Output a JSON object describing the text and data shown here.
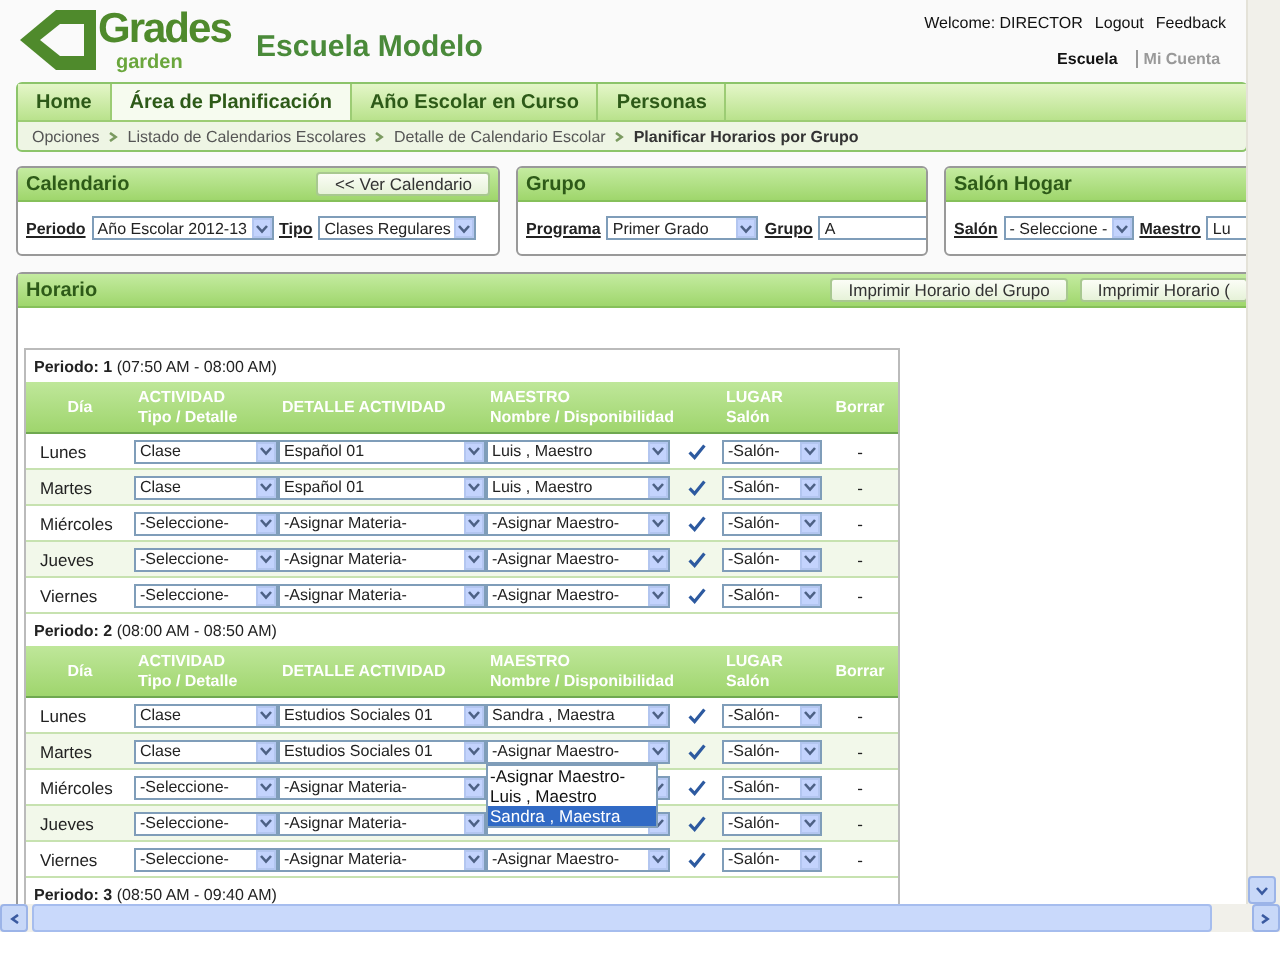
{
  "logo": {
    "main": "Grades",
    "sub": "garden"
  },
  "school_name": "Escuela Modelo",
  "user_links": [
    "Welcome: DIRECTOR",
    "Logout",
    "Feedback"
  ],
  "account_links": [
    {
      "label": "Escuela",
      "selected": true
    },
    {
      "label": "Mi Cuenta",
      "selected": false
    }
  ],
  "tabs": [
    {
      "label": "Home",
      "selected": false
    },
    {
      "label": "Área de Planificación",
      "selected": true
    },
    {
      "label": "Año Escolar en Curso",
      "selected": false
    },
    {
      "label": "Personas",
      "selected": false
    }
  ],
  "breadcrumb": [
    "Opciones",
    "Listado de Calendarios Escolares",
    "Detalle de Calendario Escolar",
    "Planificar Horarios por Grupo"
  ],
  "filter_panels": [
    {
      "title": "Calendario",
      "button": "<< Ver Calendario",
      "fields": [
        {
          "label": "Periodo",
          "value": "Año Escolar 2012-13"
        },
        {
          "label": "Tipo",
          "value": "Clases Regulares"
        }
      ]
    },
    {
      "title": "Grupo",
      "fields": [
        {
          "label": "Programa",
          "value": "Primer Grado"
        },
        {
          "label": "Grupo",
          "value": "A"
        }
      ]
    },
    {
      "title": "Salón Hogar",
      "fields": [
        {
          "label": "Salón",
          "value": "- Seleccione -"
        },
        {
          "label": "Maestro",
          "value": "Lu"
        }
      ]
    }
  ],
  "schedule": {
    "title": "Horario",
    "buttons": [
      "Imprimir Horario del Grupo",
      "Imprimir Horario ("
    ],
    "periods": [
      {
        "label": "Periodo: 1",
        "time": "(07:50 AM - 08:00 AM)",
        "columns": [
          [
            "Día"
          ],
          [
            "ACTIVIDAD",
            "Tipo / Detalle"
          ],
          [
            "DETALLE ACTIVIDAD"
          ],
          [
            "MAESTRO",
            "Nombre / Disponibilidad"
          ],
          [],
          [
            "LUGAR",
            "Salón"
          ],
          [
            "Borrar"
          ]
        ],
        "rows": [
          {
            "day": "Lunes",
            "activity": "Clase",
            "detail": "Español 01",
            "teacher": "Luis , Maestro",
            "available": true,
            "place": "-Salón-",
            "delete": "-"
          },
          {
            "day": "Martes",
            "activity": "Clase",
            "detail": "Español 01",
            "teacher": "Luis , Maestro",
            "available": true,
            "place": "-Salón-",
            "delete": "-"
          },
          {
            "day": "Miércoles",
            "activity": "-Seleccione-",
            "detail": "-Asignar Materia-",
            "teacher": "-Asignar Maestro-",
            "available": true,
            "place": "-Salón-",
            "delete": "-"
          },
          {
            "day": "Jueves",
            "activity": "-Seleccione-",
            "detail": "-Asignar Materia-",
            "teacher": "-Asignar Maestro-",
            "available": true,
            "place": "-Salón-",
            "delete": "-"
          },
          {
            "day": "Viernes",
            "activity": "-Seleccione-",
            "detail": "-Asignar Materia-",
            "teacher": "-Asignar Maestro-",
            "available": true,
            "place": "-Salón-",
            "delete": "-"
          }
        ]
      },
      {
        "label": "Periodo: 2",
        "time": "(08:00 AM - 08:50 AM)",
        "columns": [
          [
            "Día"
          ],
          [
            "ACTIVIDAD",
            "Tipo / Detalle"
          ],
          [
            "DETALLE ACTIVIDAD"
          ],
          [
            "MAESTRO",
            "Nombre / Disponibilidad"
          ],
          [],
          [
            "LUGAR",
            "Salón"
          ],
          [
            "Borrar"
          ]
        ],
        "rows": [
          {
            "day": "Lunes",
            "activity": "Clase",
            "detail": "Estudios Sociales 01",
            "teacher": "Sandra , Maestra",
            "available": true,
            "place": "-Salón-",
            "delete": "-"
          },
          {
            "day": "Martes",
            "activity": "Clase",
            "detail": "Estudios Sociales 01",
            "teacher": "-Asignar Maestro-",
            "available": true,
            "place": "-Salón-",
            "delete": "-",
            "teacher_options": [
              {
                "label": "-Asignar Maestro-",
                "selected": false
              },
              {
                "label": "Luis , Maestro",
                "selected": false
              },
              {
                "label": "Sandra , Maestra",
                "selected": true
              }
            ]
          },
          {
            "day": "Miércoles",
            "activity": "-Seleccione-",
            "detail": "-Asignar Materia-",
            "available": true,
            "place": "-Salón-",
            "delete": "-"
          },
          {
            "day": "Jueves",
            "activity": "-Seleccione-",
            "detail": "-Asignar Materia-",
            "available": true,
            "place": "-Salón-",
            "delete": "-"
          },
          {
            "day": "Viernes",
            "activity": "-Seleccione-",
            "detail": "-Asignar Materia-",
            "teacher": "-Asignar Maestro-",
            "available": true,
            "place": "-Salón-",
            "delete": "-"
          }
        ]
      },
      {
        "label": "Periodo: 3",
        "time": "(08:50 AM - 09:40 AM)"
      }
    ]
  }
}
